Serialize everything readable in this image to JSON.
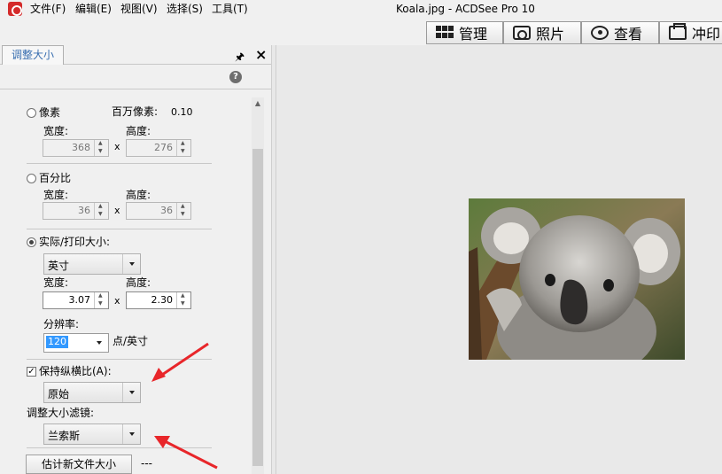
{
  "menu": [
    "文件(F)",
    "编辑(E)",
    "视图(V)",
    "选择(S)",
    "工具(T)"
  ],
  "window_title": "Koala.jpg - ACDSee Pro 10",
  "modes": {
    "manage": "管理",
    "photo": "照片",
    "view": "查看",
    "print": "冲印"
  },
  "panel": {
    "tab": "调整大小",
    "pixels": {
      "label": "像素",
      "megapixel_label": "百万像素:",
      "megapixel_value": "0.10",
      "width_label": "宽度:",
      "height_label": "高度:",
      "width": "368",
      "height": "276"
    },
    "percent": {
      "label": "百分比",
      "width_label": "宽度:",
      "height_label": "高度:",
      "width": "36",
      "height": "36"
    },
    "actual": {
      "label": "实际/打印大小:",
      "unit": "英寸",
      "width_label": "宽度:",
      "height_label": "高度:",
      "width": "3.07",
      "height": "2.30",
      "resolution_label": "分辨率:",
      "resolution": "120",
      "resolution_unit": "点/英寸"
    },
    "keep_aspect": {
      "label": "保持纵横比(A):",
      "value": "原始"
    },
    "filter": {
      "label": "调整大小滤镜:",
      "value": "兰索斯"
    },
    "estimate_button": "估计新文件大小",
    "estimate_value": "---",
    "x": "x"
  }
}
